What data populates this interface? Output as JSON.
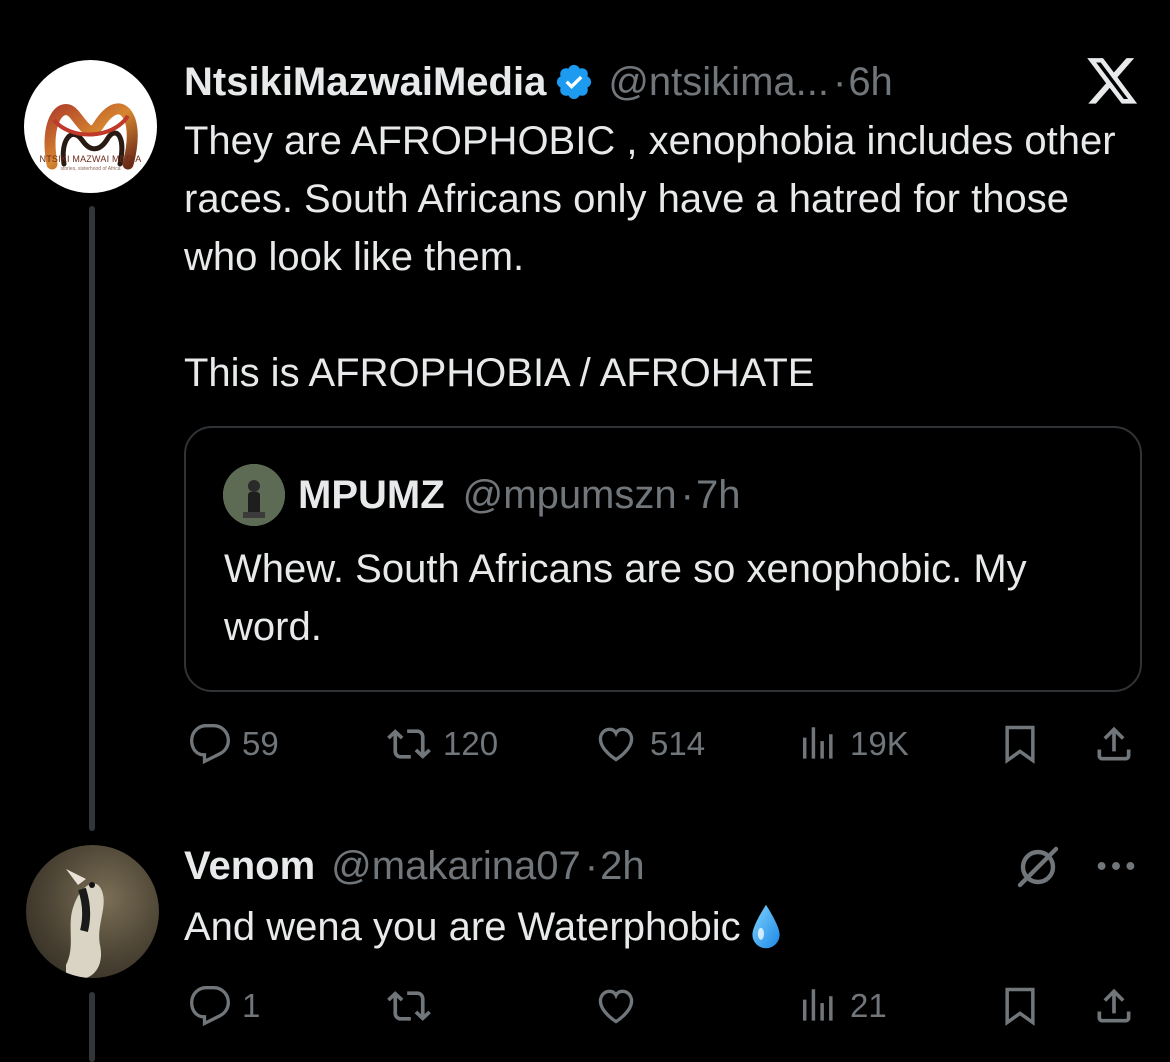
{
  "main_tweet": {
    "author": {
      "display_name": "NtsikiMazwaiMedia",
      "handle": "@ntsikima...",
      "dot": "·",
      "time": "6h",
      "avatar_text": "NTSIKI MAZWAI MEDIA",
      "avatar_subtext": "stories, sisterhood of Africa"
    },
    "text_paragraph_1": "They are AFROPHOBIC , xenophobia includes other races. South Africans only have a hatred for those who look like them.",
    "text_paragraph_2": "This is AFROPHOBIA / AFROHATE",
    "quote": {
      "display_name": "MPUMZ",
      "handle": "@mpumszn",
      "dot": "·",
      "time": "7h",
      "text": "Whew. South Africans are so xenophobic. My word."
    },
    "actions": {
      "replies": "59",
      "reposts": "120",
      "likes": "514",
      "views": "19K"
    }
  },
  "reply_tweet": {
    "author": {
      "display_name": "Venom",
      "handle": "@makarina07",
      "dot": "·",
      "time": "2h"
    },
    "text": "And wena you are Waterphobic",
    "emoji": "💧",
    "actions": {
      "replies": "1",
      "reposts": "",
      "likes": "",
      "views": "21"
    }
  },
  "colors": {
    "background": "#000000",
    "text_primary": "#e7e9ea",
    "text_secondary": "#71767b",
    "verified_badge": "#1d9bf0",
    "border": "#2f3336"
  }
}
